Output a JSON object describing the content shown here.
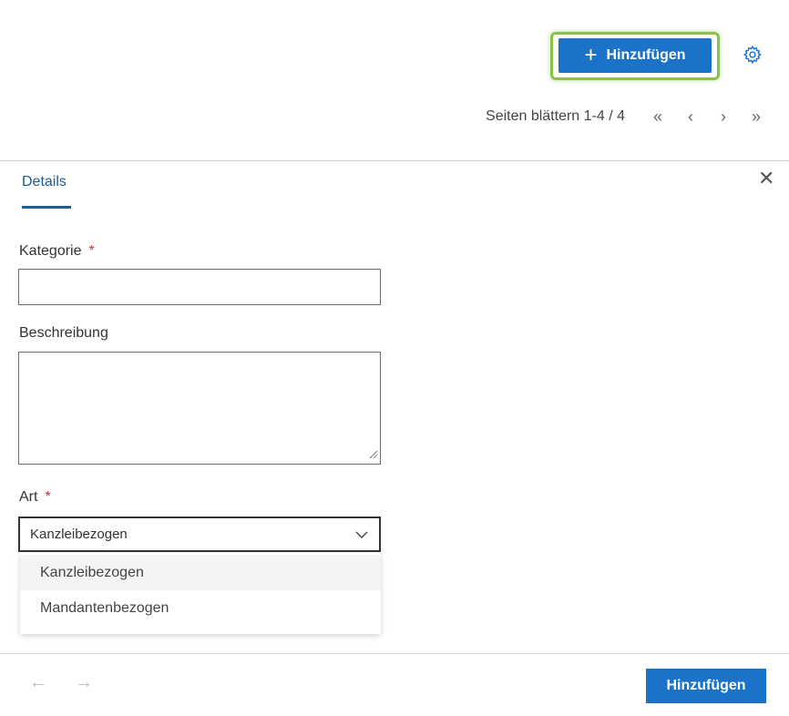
{
  "toolbar": {
    "add_button_label": "Hinzufügen",
    "add_icon": "plus-icon",
    "settings_icon": "gear-icon",
    "highlight_color": "#8bc34a",
    "primary_color": "#1a73c8"
  },
  "pager": {
    "text": "Seiten blättern 1-4 / 4",
    "first": "«",
    "prev": "‹",
    "next": "›",
    "last": "»"
  },
  "panel": {
    "tab_label": "Details",
    "close_icon": "close-icon",
    "fields": {
      "kategorie": {
        "label": "Kategorie",
        "required": "*",
        "value": ""
      },
      "beschreibung": {
        "label": "Beschreibung",
        "value": ""
      },
      "art": {
        "label": "Art",
        "required": "*",
        "selected": "Kanzleibezogen",
        "options": [
          "Kanzleibezogen",
          "Mandantenbezogen"
        ]
      }
    }
  },
  "footer": {
    "prev_arrow": "←",
    "next_arrow": "→",
    "submit_label": "Hinzufügen"
  }
}
